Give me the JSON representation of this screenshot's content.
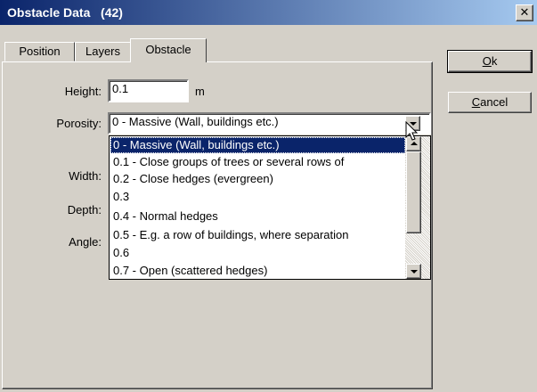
{
  "window": {
    "title": "Obstacle Data   (42)",
    "close_glyph": "✕"
  },
  "tabs": [
    {
      "label": "Position",
      "active": false
    },
    {
      "label": "Layers",
      "active": false
    },
    {
      "label": "Obstacle",
      "active": true
    }
  ],
  "form": {
    "height_label": "Height:",
    "height_value": "0.1",
    "height_unit": "m",
    "porosity_label": "Porosity:",
    "porosity_value": "0   - Massive (Wall, buildings etc.)",
    "width_label": "Width:",
    "depth_label": "Depth:",
    "angle_label": "Angle:"
  },
  "porosity_options": [
    "0   - Massive (Wall, buildings etc.)",
    "0.1 - Close groups of trees or several rows of",
    "0.2 - Close hedges (evergreen)",
    "0.3",
    "0.4 - Normal hedges",
    "0.5 - E.g. a row of buildings, where separation",
    "0.6",
    "0.7 - Open (scattered hedges)"
  ],
  "porosity_selected_index": 0,
  "buttons": {
    "ok_prefix": "",
    "ok_mnemonic": "O",
    "ok_rest": "k",
    "cancel_prefix": "",
    "cancel_mnemonic": "C",
    "cancel_rest": "ancel"
  },
  "colors": {
    "title_start": "#0a246a",
    "title_end": "#a6caf0",
    "face": "#d4d0c8",
    "highlight": "#0a246a"
  }
}
